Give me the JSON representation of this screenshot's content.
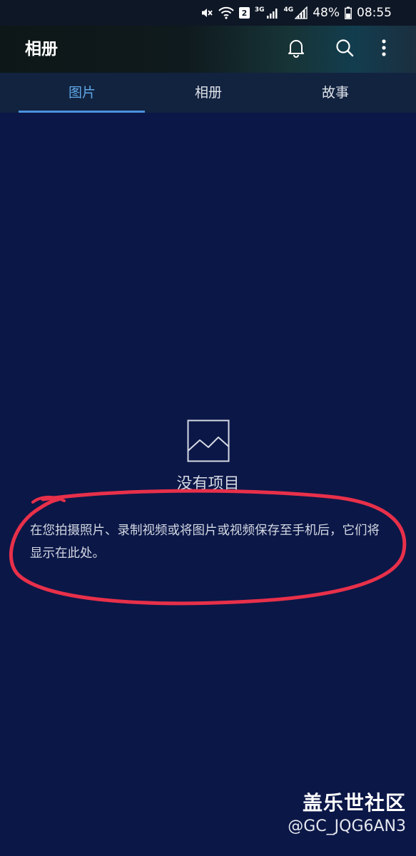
{
  "status_bar": {
    "net_1": "3G",
    "net_2": "4G",
    "sim_slot": "2",
    "battery": "48%",
    "time": "08:55",
    "icons": [
      "mute-icon",
      "wifi-icon",
      "signal-icon",
      "battery-icon"
    ]
  },
  "app_bar": {
    "title": "相册",
    "actions": [
      "bell-icon",
      "search-icon",
      "more-vert-icon"
    ]
  },
  "tabs": [
    {
      "label": "图片",
      "active": true
    },
    {
      "label": "相册",
      "active": false
    },
    {
      "label": "故事",
      "active": false
    }
  ],
  "empty_state": {
    "icon": "image-placeholder-icon",
    "title": "没有项目",
    "description": "在您拍摄照片、录制视频或将图片或视频保存至手机后，它们将显示在此处。"
  },
  "watermark": {
    "title": "盖乐世社区",
    "user": "@GC_JQG6AN3"
  },
  "colors": {
    "background": "#0b1747",
    "tab_active": "#5fa8e8",
    "annotation": "#e8304a"
  }
}
